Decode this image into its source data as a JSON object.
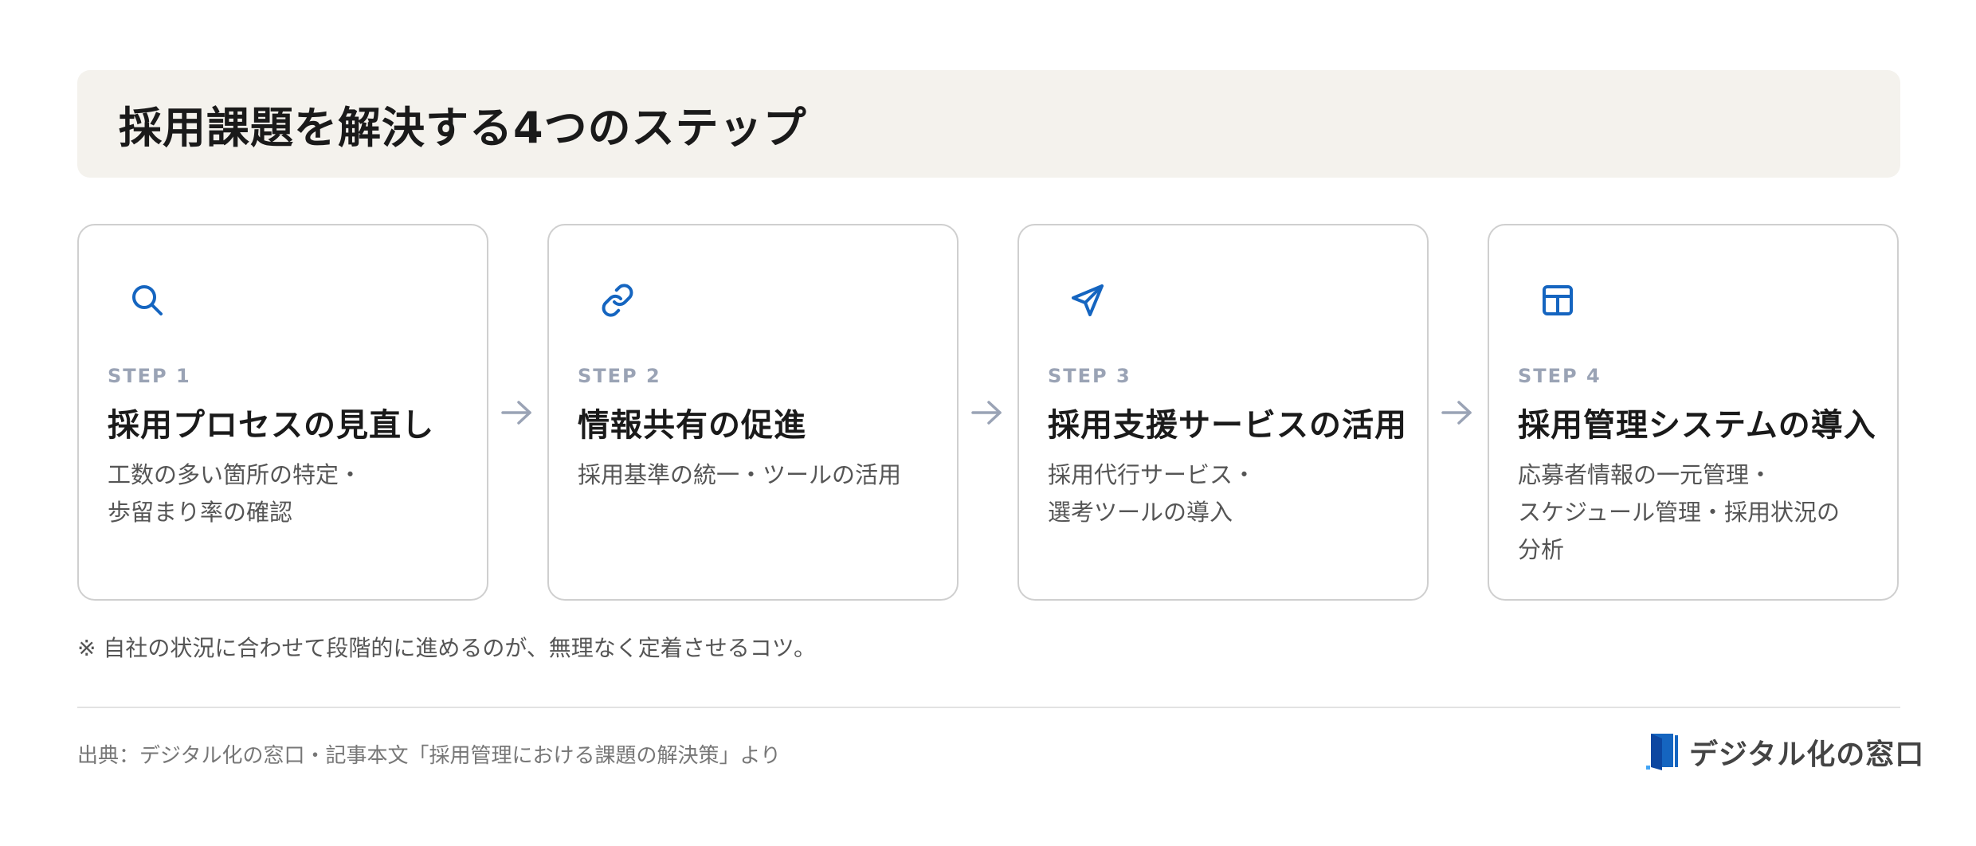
{
  "header": {
    "title": "採用課題を解決する4つのステップ"
  },
  "steps": [
    {
      "step": "STEP 1",
      "title": "採用プロセスの見直し",
      "desc_lines": [
        "工数の多い箇所の特定・",
        "歩留まり率の確認"
      ],
      "icon": "search-icon"
    },
    {
      "step": "STEP 2",
      "title": "情報共有の促進",
      "desc_lines": [
        "採用基準の統一・ツールの活用"
      ],
      "icon": "link-icon"
    },
    {
      "step": "STEP 3",
      "title": "採用支援サービスの活用",
      "desc_lines": [
        "採用代行サービス・",
        "選考ツールの導入"
      ],
      "icon": "send-icon"
    },
    {
      "step": "STEP 4",
      "title": "採用管理システムの導入",
      "desc_lines": [
        "応募者情報の一元管理・",
        "スケジュール管理・採用状況の",
        "分析"
      ],
      "icon": "layout-icon"
    }
  ],
  "note": "※ 自社の状況に合わせて段階的に進めるのが、無理なく定着させるコツ。",
  "footer": {
    "source": "出典：デジタル化の窓口・記事本文「採用管理における課題の解決策」より",
    "brand": "デジタル化の窓口"
  },
  "colors": {
    "accent": "#1565c0",
    "title_bg": "#f4f2ed",
    "step_label": "#9aa3b5",
    "arrow": "#9aa3b5"
  }
}
